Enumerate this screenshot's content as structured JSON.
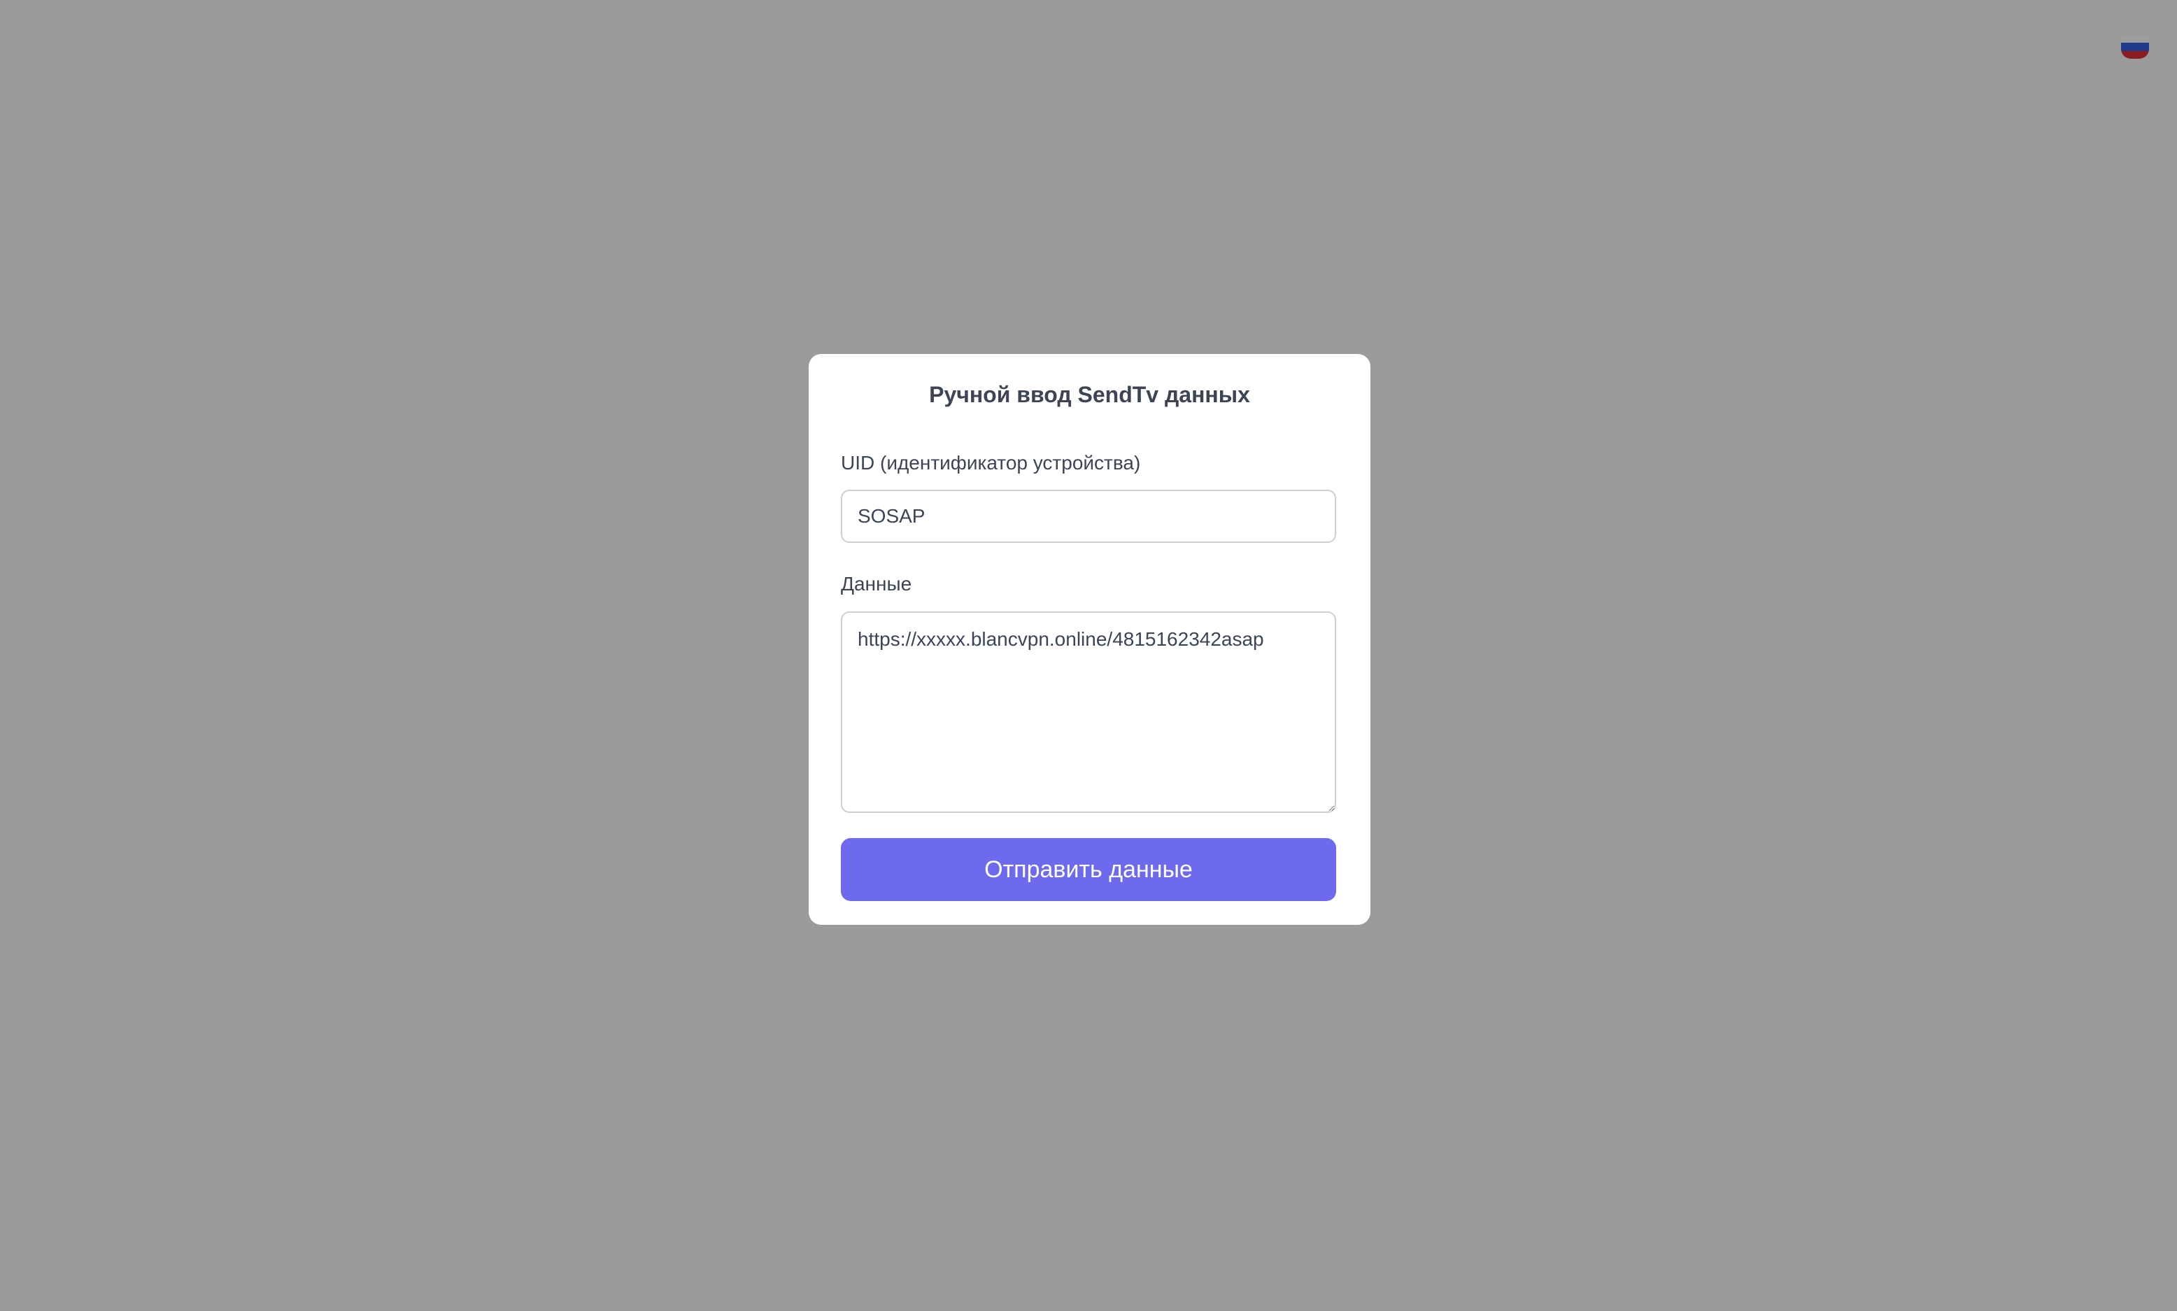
{
  "colors": {
    "overlay": "#9b9b9b",
    "accent": "#6d6aee",
    "text": "#3b4556"
  },
  "language_flag": {
    "icon": "russia-flag-icon"
  },
  "dialog": {
    "title": "Ручной ввод SendTv данных",
    "uid_label": "UID (идентификатор устройства)",
    "uid_value": "SOSAP",
    "data_label": "Данные",
    "data_value": "https://xxxxx.blancvpn.online/4815162342asap",
    "submit_label": "Отправить данные"
  }
}
